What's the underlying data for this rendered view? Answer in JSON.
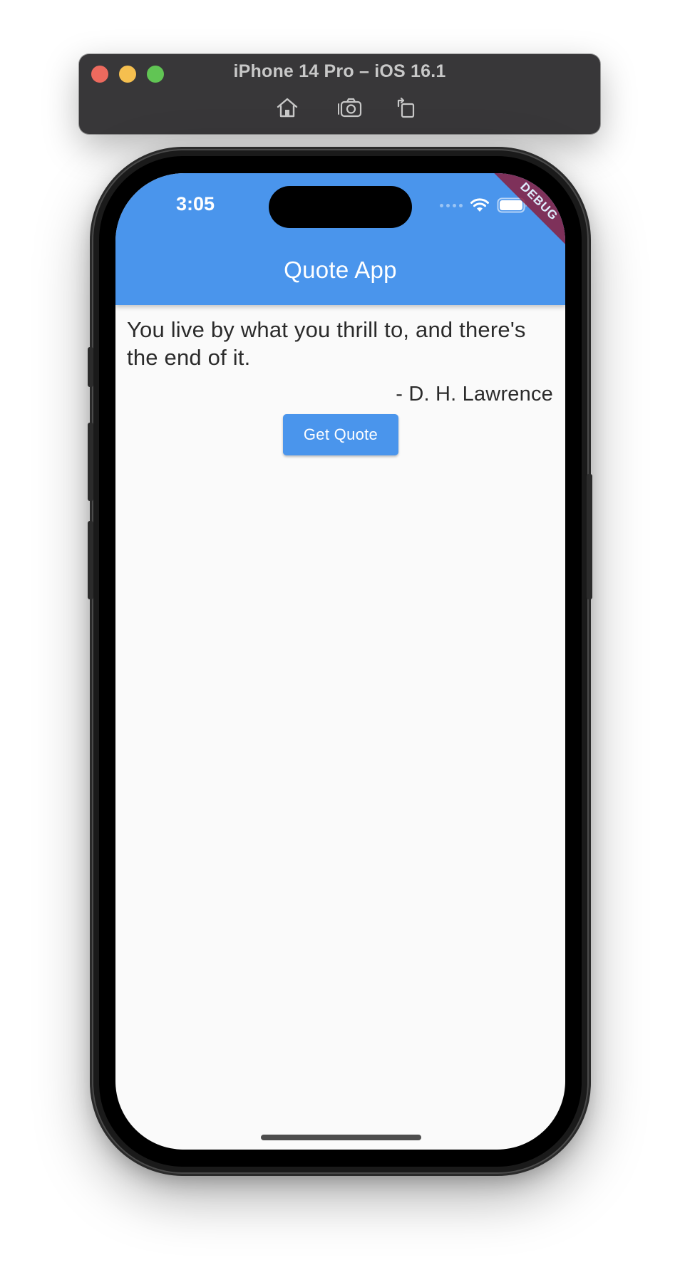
{
  "simulator": {
    "title": "iPhone 14 Pro – iOS 16.1",
    "toolbar": {
      "home_icon": "home-icon",
      "screenshot_icon": "camera-icon",
      "rotate_icon": "rotate-icon"
    }
  },
  "status_bar": {
    "time": "3:05",
    "icons": [
      "cellular-signal-icon",
      "wifi-icon",
      "battery-icon"
    ]
  },
  "debug_banner": "DEBUG",
  "app_bar": {
    "title": "Quote App"
  },
  "quote": {
    "text": "You live by what you thrill to, and there's the end of it.",
    "author": "- D. H. Lawrence"
  },
  "actions": {
    "get_quote_label": "Get Quote"
  },
  "colors": {
    "primary": "#4a95ec",
    "background": "#fafafa",
    "text": "#2b2b2b",
    "debug_ribbon": "#8a1b3a",
    "window_chrome": "#383739"
  }
}
